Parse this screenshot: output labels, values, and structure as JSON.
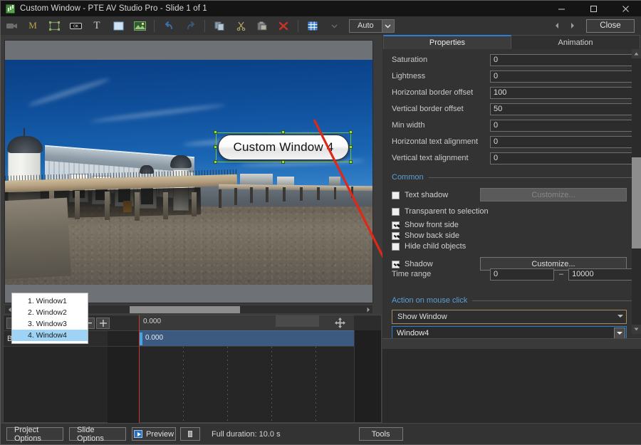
{
  "window": {
    "title": "Custom Window - PTE AV Studio Pro - Slide 1 of 1",
    "app_icon": "pte-app-icon",
    "minimize": "minimize-icon",
    "maximize": "maximize-icon",
    "close": "close-icon"
  },
  "toolbar": {
    "buttons": [
      {
        "name": "video-object-icon",
        "glyph": "video"
      },
      {
        "name": "mask-object-icon",
        "glyph": "M"
      },
      {
        "name": "frame-object-icon",
        "glyph": "frame"
      },
      {
        "name": "button-object-icon",
        "glyph": "button"
      },
      {
        "name": "text-object-icon",
        "glyph": "T"
      },
      {
        "name": "rectangle-object-icon",
        "glyph": "rect"
      },
      {
        "name": "image-object-icon",
        "glyph": "image"
      },
      {
        "name": "undo-icon",
        "glyph": "undo"
      },
      {
        "name": "redo-icon",
        "glyph": "redo"
      },
      {
        "name": "copy-icon",
        "glyph": "copy"
      },
      {
        "name": "cut-icon",
        "glyph": "cut"
      },
      {
        "name": "paste-icon",
        "glyph": "paste"
      },
      {
        "name": "delete-icon",
        "glyph": "delete"
      },
      {
        "name": "grid-icon",
        "glyph": "grid"
      }
    ],
    "zoom_value": "Auto",
    "prev_slide": "prev-slide-icon",
    "next_slide": "next-slide-icon",
    "close_label": "Close"
  },
  "canvas": {
    "object_label": "Custom Window 4",
    "selection_color": "#9cd94a",
    "arrow_color": "#e02718"
  },
  "timeline": {
    "buttons": [
      {
        "name": "play-button",
        "glyph": "▶"
      },
      {
        "name": "stop-button",
        "glyph": "■"
      },
      {
        "name": "waveform-button",
        "glyph": "∿"
      },
      {
        "name": "prev-keyframe-button",
        "glyph": "←"
      },
      {
        "name": "next-keyframe-button",
        "glyph": "→"
      },
      {
        "name": "zoom-out-button",
        "glyph": "−"
      },
      {
        "name": "zoom-in-button",
        "glyph": "+"
      }
    ],
    "ruler_time": "0.000",
    "track_name": "Button1",
    "clip_time": "0.000",
    "move_tool": "move-tool-icon"
  },
  "bottom_bar": {
    "project_options": "Project Options",
    "slide_options": "Slide Options",
    "preview": "Preview",
    "fullscreen": "fullscreen-preview-icon",
    "full_duration": "Full duration: 10.0 s",
    "tools": "Tools"
  },
  "panel": {
    "tabs": [
      {
        "label": "Properties",
        "active": true
      },
      {
        "label": "Animation",
        "active": false
      }
    ],
    "properties": [
      {
        "label": "Saturation",
        "value": "0"
      },
      {
        "label": "Lightness",
        "value": "0"
      },
      {
        "label": "Horizontal border offset",
        "value": "100"
      },
      {
        "label": "Vertical border offset",
        "value": "50"
      },
      {
        "label": "Min width",
        "value": "0"
      },
      {
        "label": "Horizontal text alignment",
        "value": "0"
      },
      {
        "label": "Vertical text alignment",
        "value": "0"
      }
    ],
    "common": {
      "section_title": "Common",
      "checkboxes": [
        {
          "label": "Text shadow",
          "checked": false
        },
        {
          "label": "Transparent to selection",
          "checked": false
        },
        {
          "label": "Show front side",
          "checked": true
        },
        {
          "label": "Show back side",
          "checked": true
        },
        {
          "label": "Hide child objects",
          "checked": false
        },
        {
          "label": "Shadow",
          "checked": true
        }
      ],
      "text_shadow_customize": "Customize...",
      "shadow_customize": "Customize...",
      "time_range_label": "Time range",
      "time_range_from": "0",
      "time_range_dash": "–",
      "time_range_to": "10000"
    },
    "action": {
      "section_title": "Action on mouse click",
      "action_value": "Show Window",
      "window_value": "Window4",
      "dropdown_options": [
        {
          "label": "1. Window1",
          "selected": false
        },
        {
          "label": "2. Window2",
          "selected": false
        },
        {
          "label": "3. Window3",
          "selected": false
        },
        {
          "label": "4. Window4",
          "selected": true
        }
      ]
    }
  },
  "colors": {
    "accent_blue": "#2a7fd4",
    "section_blue": "#5a9fd4",
    "highlight": "#9fd3f5",
    "selection_green": "#9cd94a",
    "arrow_red": "#e02718"
  }
}
